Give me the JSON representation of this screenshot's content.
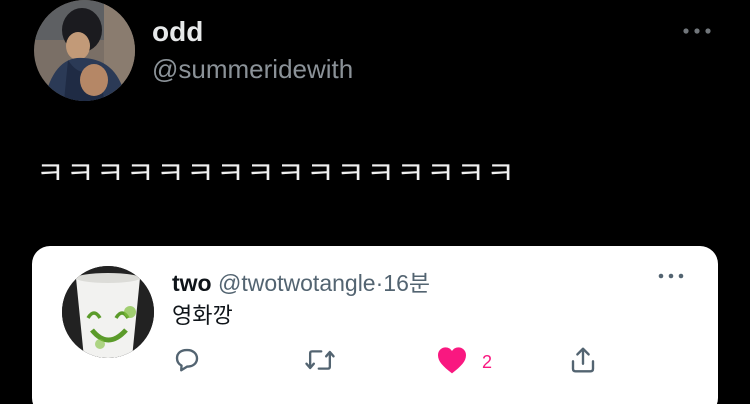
{
  "tweet": {
    "author": {
      "display_name": "odd",
      "handle": "@summeridewith",
      "avatar": "profile-photo-person-avatar"
    },
    "more_icon": "more-horizontal-icon",
    "text": "ㅋㅋㅋㅋㅋㅋㅋㅋㅋㅋㅋㅋㅋㅋㅋㅋ"
  },
  "quoted_tweet": {
    "author": {
      "display_name": "two",
      "handle": "@twotwotangle",
      "avatar": "paper-cup-face-avatar"
    },
    "separator": "·",
    "time": "16분",
    "text": "영화깡",
    "more_icon": "more-horizontal-icon",
    "actions": {
      "reply_icon": "reply-icon",
      "retweet_icon": "retweet-icon",
      "like_icon": "heart-filled-icon",
      "like_count": "2",
      "share_icon": "share-icon"
    },
    "colors": {
      "like": "#f91880",
      "secondary_text": "#536471",
      "card_background": "#ffffff"
    }
  }
}
